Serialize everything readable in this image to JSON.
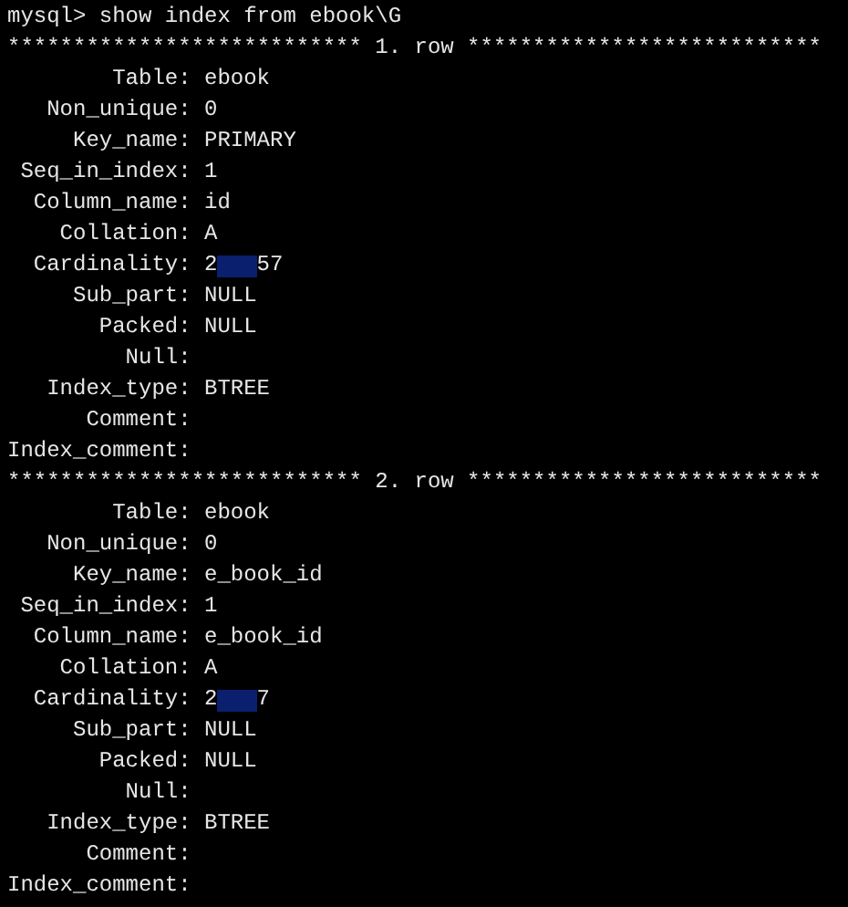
{
  "prompt": "mysql> show index from ebook\\G",
  "records": [
    {
      "separator": "*************************** 1. row ***************************",
      "fields": [
        {
          "label": "Table:",
          "value": "ebook"
        },
        {
          "label": "Non_unique:",
          "value": "0"
        },
        {
          "label": "Key_name:",
          "value": "PRIMARY"
        },
        {
          "label": "Seq_in_index:",
          "value": "1"
        },
        {
          "label": "Column_name:",
          "value": "id"
        },
        {
          "label": "Collation:",
          "value": "A"
        },
        {
          "label": "Cardinality:",
          "value": "2",
          "redacted": true,
          "value_tail": "57"
        },
        {
          "label": "Sub_part:",
          "value": "NULL"
        },
        {
          "label": "Packed:",
          "value": "NULL"
        },
        {
          "label": "Null:"
        },
        {
          "label": "Index_type:",
          "value": "BTREE"
        },
        {
          "label": "Comment:"
        },
        {
          "label": "Index_comment:"
        }
      ]
    },
    {
      "separator": "*************************** 2. row ***************************",
      "fields": [
        {
          "label": "Table:",
          "value": "ebook"
        },
        {
          "label": "Non_unique:",
          "value": "0"
        },
        {
          "label": "Key_name:",
          "value": "e_book_id"
        },
        {
          "label": "Seq_in_index:",
          "value": "1"
        },
        {
          "label": "Column_name:",
          "value": "e_book_id"
        },
        {
          "label": "Collation:",
          "value": "A"
        },
        {
          "label": "Cardinality:",
          "value": "2",
          "redacted": true,
          "value_tail": "7"
        },
        {
          "label": "Sub_part:",
          "value": "NULL"
        },
        {
          "label": "Packed:",
          "value": "NULL"
        },
        {
          "label": "Null:"
        },
        {
          "label": "Index_type:",
          "value": "BTREE"
        },
        {
          "label": "Comment:"
        },
        {
          "label": "Index_comment:"
        }
      ]
    }
  ]
}
